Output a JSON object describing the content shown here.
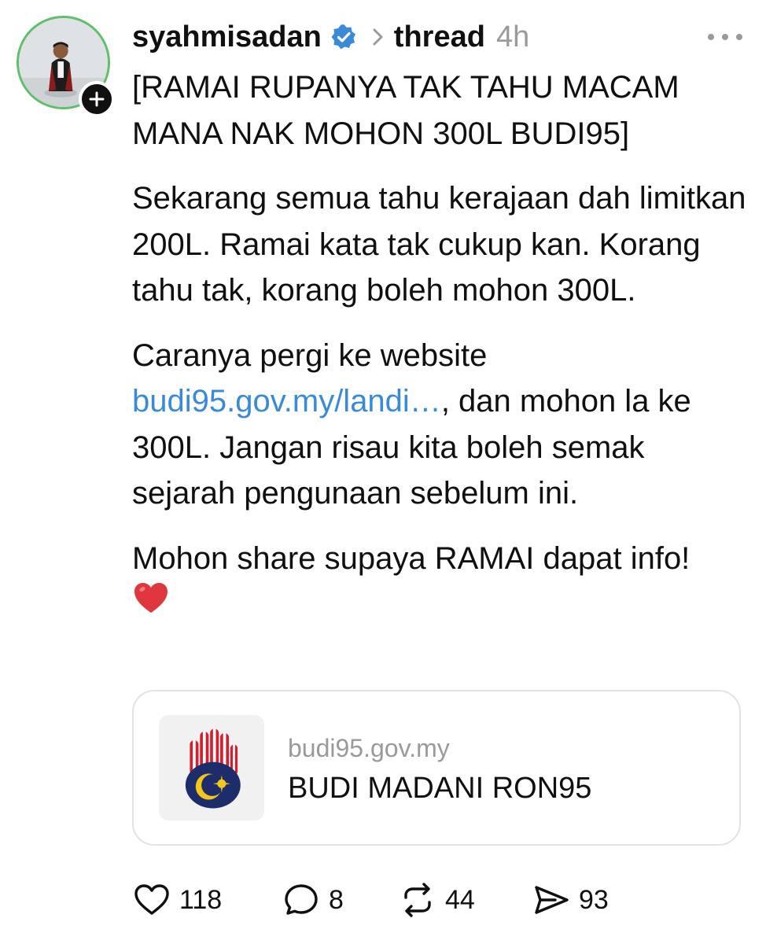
{
  "post": {
    "username": "syahmisadan",
    "thread_label": "thread",
    "time": "4h",
    "paragraphs": {
      "title": "[RAMAI RUPANYA TAK TAHU MACAM MANA NAK MOHON 300L BUDI95]",
      "p1": "Sekarang semua tahu kerajaan dah limitkan 200L. Ramai kata tak cukup kan. Korang tahu tak, korang boleh mohon 300L.",
      "p2_before": "Caranya pergi ke website",
      "p2_link": "budi95.gov.my/landi…",
      "p2_after": ", dan mohon la ke 300L. Jangan risau kita boleh semak sejarah pengunaan sebelum ini.",
      "p3": "Mohon share supaya RAMAI dapat info!"
    },
    "icons": {
      "verified": "verified-badge-icon",
      "heart_emoji": "red-heart-emoji"
    }
  },
  "link_card": {
    "domain": "budi95.gov.my",
    "title": "BUDI MADANI RON95",
    "thumbnail": "budi-madani-logo"
  },
  "actions": {
    "likes": "118",
    "replies": "8",
    "reposts": "44",
    "shares": "93"
  },
  "colors": {
    "link": "#3b8ad8",
    "verified": "#3b8ad8",
    "avatar_ring": "#5fbf6a",
    "muted": "#9a9a9a"
  }
}
